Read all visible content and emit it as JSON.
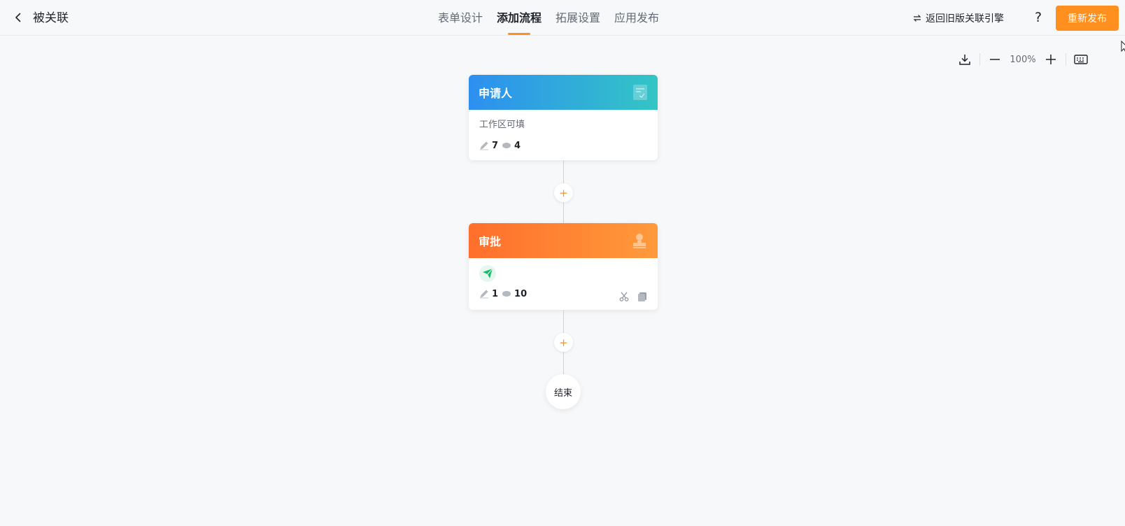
{
  "header": {
    "title": "被关联",
    "tabs": [
      {
        "label": "表单设计"
      },
      {
        "label": "添加流程"
      },
      {
        "label": "拓展设置"
      },
      {
        "label": "应用发布"
      }
    ],
    "active_tab": "添加流程",
    "old_engine_label": "返回旧版关联引擎",
    "help_label": "?",
    "publish_label": "重新发布",
    "accent_color": "#ff8f1f"
  },
  "toolbar": {
    "zoom": "100%",
    "icons": [
      "download-icon",
      "zoom-out-icon",
      "zoom-in-icon",
      "keyboard-icon"
    ]
  },
  "flow": {
    "applicant": {
      "title": "申请人",
      "desc": "工作区可填",
      "edit_count": "7",
      "view_count": "4",
      "header_color_start": "#2d8ff0",
      "header_color_end": "#33c5c5"
    },
    "approval": {
      "title": "审批",
      "edit_count": "1",
      "view_count": "10",
      "header_color_start": "#ff6f2c",
      "header_color_end": "#ff9a3b"
    },
    "add_symbol": "+",
    "end_label": "结束"
  }
}
